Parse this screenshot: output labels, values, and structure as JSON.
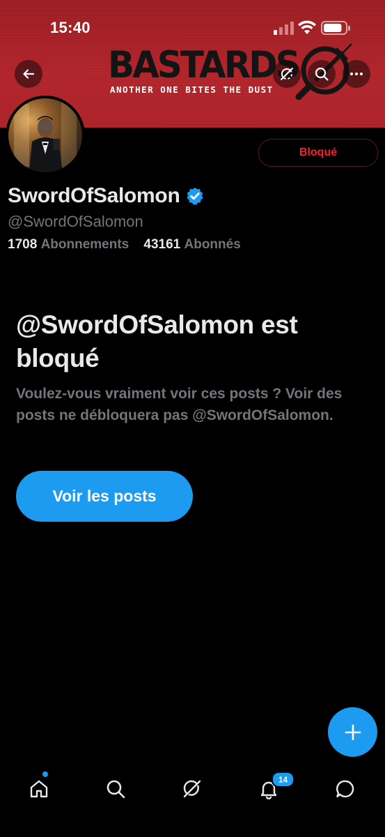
{
  "status_bar": {
    "time": "15:40",
    "signal_icon": "cellular-signal-icon",
    "wifi_icon": "wifi-icon",
    "battery_icon": "battery-icon",
    "battery_level": 0.85
  },
  "header": {
    "back_icon": "arrow-left-icon",
    "grok_icon": "grok-icon",
    "search_icon": "search-icon",
    "more_icon": "more-horizontal-icon",
    "banner_logo": "BASTARDS",
    "banner_tagline": "ANOTHER ONE BITES THE DUST"
  },
  "profile": {
    "display_name": "SwordOfSalomon",
    "verified_icon": "verified-badge-icon",
    "handle": "@SwordOfSalomon",
    "following_count": "1708",
    "following_label": "Abonnements",
    "followers_count": "43161",
    "followers_label": "Abonnés",
    "blocked_button_label": "Bloqué"
  },
  "blocked_notice": {
    "title": "@SwordOfSalomon est bloqué",
    "description": "Voulez-vous vraiment voir ces posts ? Voir des posts ne débloquera pas @SwordOfSalomon.",
    "view_posts_label": "Voir les posts"
  },
  "fab": {
    "icon": "plus-icon"
  },
  "tab_bar": {
    "home_icon": "home-icon",
    "search_icon": "search-icon",
    "grok_icon": "grok-icon",
    "notifications_icon": "bell-icon",
    "notifications_badge": "14",
    "messages_icon": "chat-bubble-icon"
  },
  "colors": {
    "accent": "#1d9bf0",
    "blocked_red": "#f4212e",
    "banner_red": "#b5262c",
    "background": "#000000",
    "secondary_text": "#71767b"
  }
}
